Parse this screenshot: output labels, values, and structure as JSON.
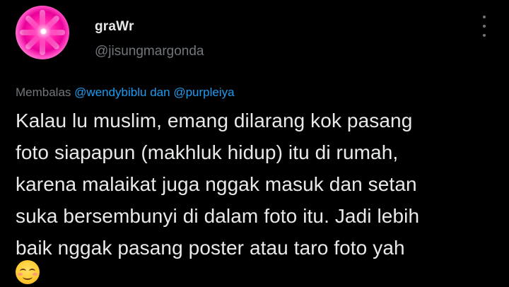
{
  "tweet": {
    "author": {
      "display_name": "graWr",
      "handle": "@jisungmargonda"
    },
    "more_icon": "more-horizontal-icon",
    "reply_context": {
      "prefix": "Membalas",
      "mention_1": "@wendybiblu",
      "conjunction": "dan",
      "mention_2": "@purpleiya"
    },
    "text_lines": [
      "Kalau lu muslim, emang dilarang kok pasang",
      "foto siapapun (makhluk hidup) itu di rumah,",
      "karena malaikat juga nggak masuk dan setan",
      "suka bersembunyi di dalam foto itu. Jadi lebih",
      "baik nggak pasang poster atau taro foto yah"
    ],
    "emoji": "smiling-face-with-smiling-eyes"
  },
  "colors": {
    "background": "#000000",
    "text_primary": "#e7e9ea",
    "text_secondary": "#71767b",
    "link": "#1d9bf0"
  }
}
